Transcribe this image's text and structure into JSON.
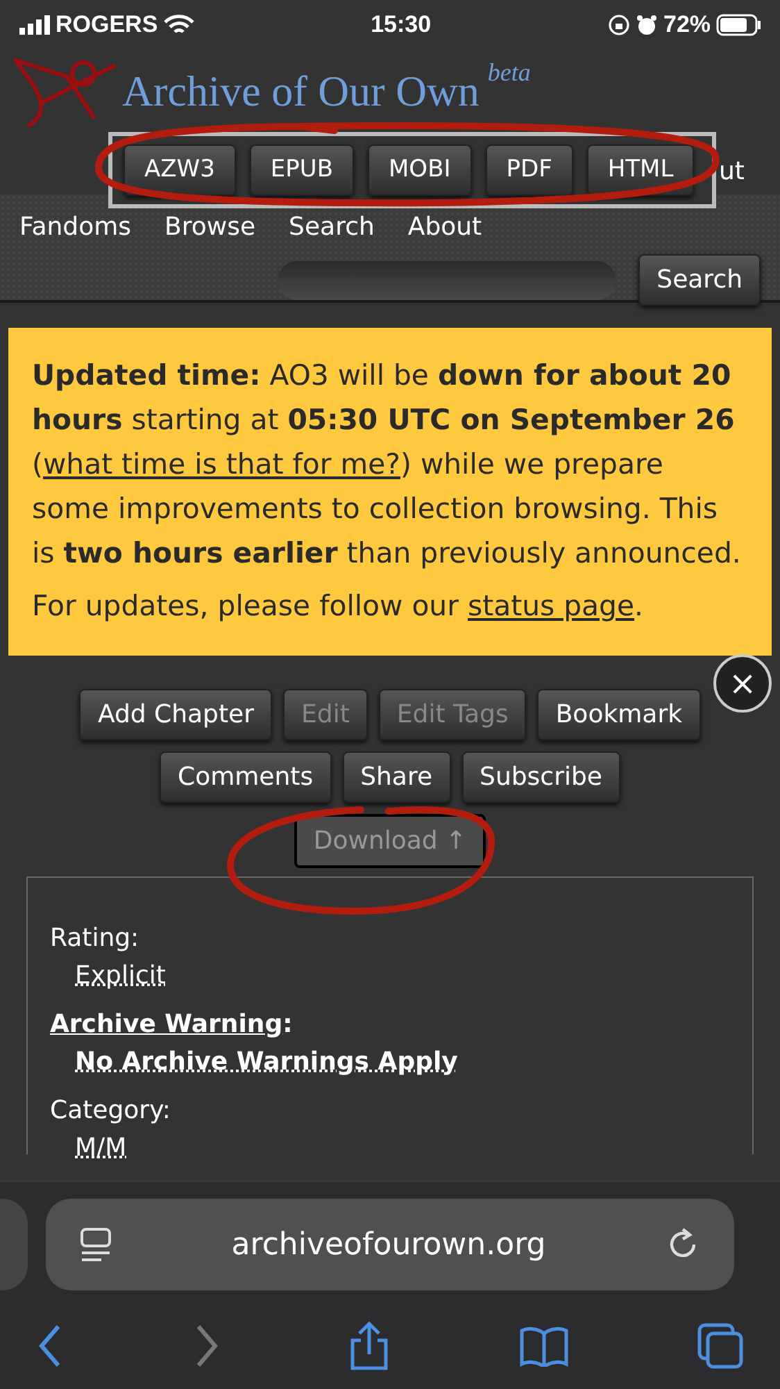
{
  "status_bar": {
    "carrier": "ROGERS",
    "time": "15:30",
    "battery": "72%"
  },
  "site": {
    "title": "Archive of Our Own",
    "badge": "beta"
  },
  "download_menu": {
    "options": [
      "AZW3",
      "EPUB",
      "MOBI",
      "PDF",
      "HTML"
    ],
    "behind_text": "ut"
  },
  "nav": {
    "items": [
      "Fandoms",
      "Browse",
      "Search",
      "About"
    ],
    "search_button": "Search"
  },
  "alert": {
    "paragraphs": [
      [
        {
          "kind": "text",
          "text": "**Updated time:** AO3 will be **down for about 20 hours** starting at **05:30 UTC on September 26** ("
        },
        {
          "kind": "link",
          "text": "what time is that for me?"
        },
        {
          "kind": "text",
          "text": ") while we prepare some improvements to collection browsing. This is **two hours earlier** than previously announced."
        }
      ],
      [
        {
          "kind": "text",
          "text": "For updates, please follow our "
        },
        {
          "kind": "link",
          "text": "status page"
        },
        {
          "kind": "text",
          "text": "."
        }
      ]
    ],
    "close": "×"
  },
  "actions": [
    [
      {
        "label": "Add Chapter",
        "disabled": false
      },
      {
        "label": "Edit",
        "disabled": true
      },
      {
        "label": "Edit Tags",
        "disabled": true
      },
      {
        "label": "Bookmark",
        "disabled": false
      }
    ],
    [
      {
        "label": "Comments",
        "disabled": false
      },
      {
        "label": "Share",
        "disabled": false
      },
      {
        "label": "Subscribe",
        "disabled": false
      }
    ]
  ],
  "download": {
    "label": "Download ↑",
    "expanded": true
  },
  "meta": [
    {
      "label": "Rating:",
      "label_link": false,
      "value": "Explicit",
      "value_bold": false
    },
    {
      "label": "Archive Warning",
      "label_link": true,
      "label_suffix": ":",
      "value": "No Archive Warnings Apply",
      "value_bold": true
    },
    {
      "label": "Category:",
      "label_link": false,
      "value": "M/M",
      "value_bold": false
    }
  ],
  "browser": {
    "url": "archiveofourown.org",
    "forward_disabled": true
  }
}
